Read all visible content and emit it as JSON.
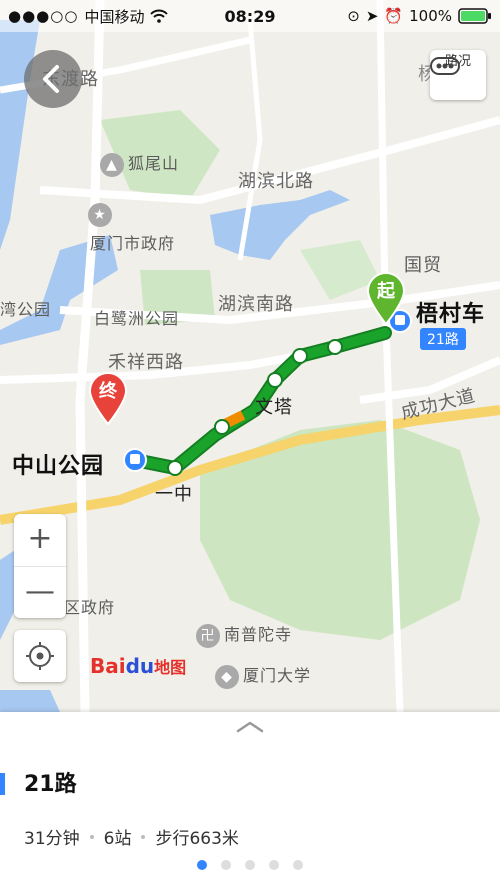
{
  "status_bar": {
    "carrier": "中国移动",
    "time": "08:29",
    "battery": "100%",
    "icons": [
      "signal-icon",
      "wifi-icon",
      "rotation-lock-icon",
      "location-arrow-icon",
      "alarm-icon",
      "battery-icon"
    ]
  },
  "map": {
    "back_button_icon": "chevron-left-icon",
    "traffic_button_label": "路况",
    "zoom_in": "+",
    "zoom_out": "—",
    "locate_icon": "locate-icon",
    "logo": {
      "part1": "Bai",
      "part2": "du",
      "part3": "地图"
    },
    "roads": [
      "东渡路",
      "湖滨北路",
      "湖滨南路",
      "禾祥西路",
      "成功大道"
    ],
    "pois": [
      "狐尾山",
      "厦门市政府",
      "白鹭洲公园",
      "湾公园",
      "区政府",
      "南普陀寺",
      "厦门大学"
    ],
    "area_labels": [
      "国贸",
      "文塔",
      "一中",
      "杨"
    ],
    "start": {
      "pin_label": "起",
      "stop_name": "梧村车",
      "route_badge": "21路"
    },
    "end": {
      "pin_label": "终",
      "stop_name": "中山公园"
    }
  },
  "route": {
    "name": "21路",
    "duration": "31分钟",
    "stops": "6站",
    "walk": "步行663米",
    "pages": 5,
    "active_page": 0
  },
  "colors": {
    "route_green": "#1aa32b",
    "start_green": "#5fb52e",
    "end_red": "#e8433b",
    "accent_blue": "#3385ff",
    "congestion_orange": "#f08c00"
  }
}
